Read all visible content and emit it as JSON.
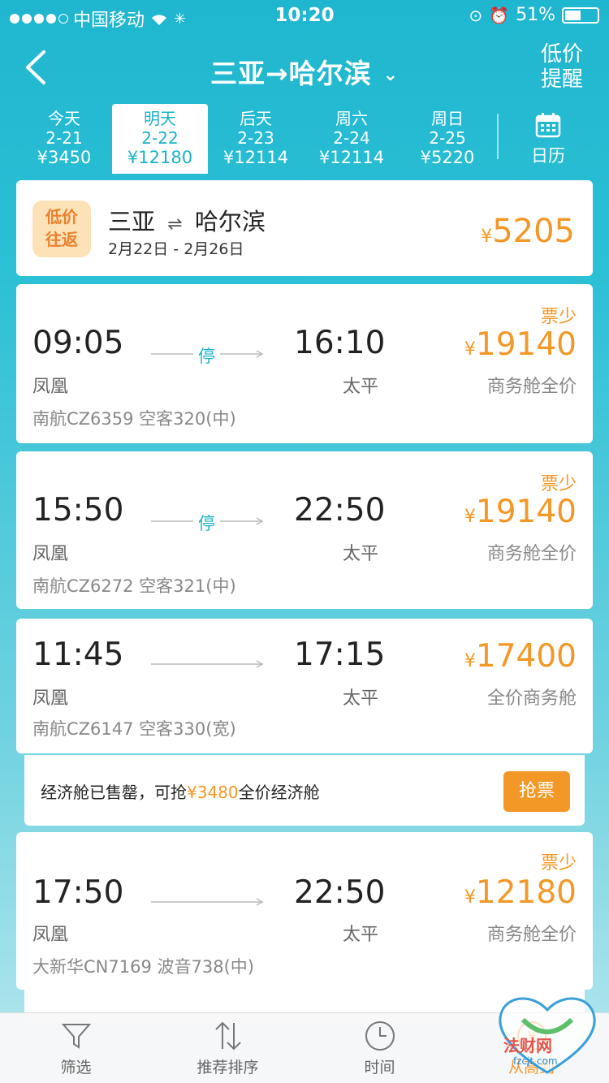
{
  "status_bar": {
    "carrier": "中国移动",
    "time": "10:20",
    "battery": "51%",
    "battery_level": 0.51
  },
  "header": {
    "route": "三亚→哈尔滨",
    "alert_line1": "低价",
    "alert_line2": "提醒"
  },
  "date_tabs": [
    {
      "day": "今天",
      "date": "2-21",
      "price": "¥3450"
    },
    {
      "day": "明天",
      "date": "2-22",
      "price": "¥12180"
    },
    {
      "day": "后天",
      "date": "2-23",
      "price": "¥12114"
    },
    {
      "day": "周六",
      "date": "2-24",
      "price": "¥12114"
    },
    {
      "day": "周日",
      "date": "2-25",
      "price": "¥5220"
    }
  ],
  "calendar_label": "日历",
  "round_trip": {
    "badge_line1": "低价",
    "badge_line2": "往返",
    "from": "三亚",
    "arrow": "⇌",
    "to": "哈尔滨",
    "dates": "2月22日 - 2月26日",
    "currency": "¥",
    "price": "5205"
  },
  "flights": [
    {
      "dep_time": "09:05",
      "arr_time": "16:10",
      "stop": "停",
      "dep_city": "凤凰",
      "arr_city": "太平",
      "flight": "南航CZ6359  空客320(中)",
      "few": "票少",
      "currency": "¥",
      "price": "19140",
      "cabin": "商务舱全价"
    },
    {
      "dep_time": "15:50",
      "arr_time": "22:50",
      "stop": "停",
      "dep_city": "凤凰",
      "arr_city": "太平",
      "flight": "南航CZ6272  空客321(中)",
      "few": "票少",
      "currency": "¥",
      "price": "19140",
      "cabin": "商务舱全价"
    },
    {
      "dep_time": "11:45",
      "arr_time": "17:15",
      "dep_city": "凤凰",
      "arr_city": "太平",
      "flight": "南航CZ6147  空客330(宽)",
      "currency": "¥",
      "price": "17400",
      "cabin": "全价商务舱"
    },
    {
      "dep_time": "17:50",
      "arr_time": "22:50",
      "dep_city": "凤凰",
      "arr_city": "太平",
      "flight": "大新华CN7169  波音738(中)",
      "few": "票少",
      "currency": "¥",
      "price": "12180",
      "cabin": "商务舱全价"
    }
  ],
  "sold_out": {
    "text_before": "经济舱已售罄，可抢",
    "amount": "¥3480",
    "text_after": "全价经济舱",
    "button": "抢票"
  },
  "tabbar": [
    {
      "label": "筛选",
      "icon": "filter-icon"
    },
    {
      "label": "推荐排序",
      "icon": "sort-icon"
    },
    {
      "label": "时间",
      "icon": "clock-icon"
    },
    {
      "label": "从高到",
      "icon": "price-icon"
    }
  ],
  "watermark": {
    "text": "法财网",
    "url": "fzcjt.com"
  },
  "colors": {
    "accent": "#1ab3c9",
    "price": "#f39826",
    "header_bg": "#1fb6cf"
  }
}
